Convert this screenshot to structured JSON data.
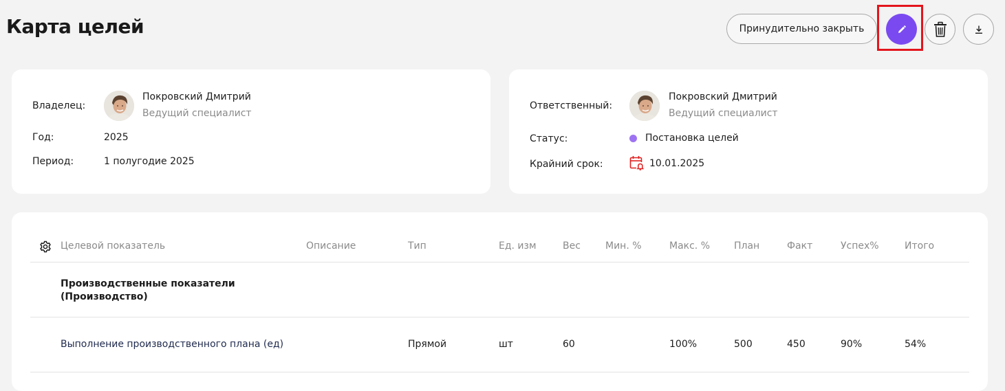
{
  "header": {
    "title": "Карта целей",
    "force_close_label": "Принудительно закрыть",
    "edit_icon": "pencil-icon",
    "delete_icon": "trash-icon",
    "download_icon": "download-icon"
  },
  "info_left": {
    "owner_label": "Владелец:",
    "owner_name": "Покровский Дмитрий",
    "owner_position": "Ведущий специалист",
    "year_label": "Год:",
    "year_value": "2025",
    "period_label": "Период:",
    "period_value": "1 полугодие 2025"
  },
  "info_right": {
    "responsible_label": "Ответственный:",
    "responsible_name": "Покровский Дмитрий",
    "responsible_position": "Ведущий специалист",
    "status_label": "Статус:",
    "status_value": "Постановка целей",
    "status_color": "#9e73f2",
    "deadline_label": "Крайний срок:",
    "deadline_value": "10.01.2025",
    "deadline_icon": "calendar-alarm-icon"
  },
  "table": {
    "settings_icon": "gear-icon",
    "columns": [
      "Целевой показатель",
      "Описание",
      "Тип",
      "Ед. изм",
      "Вес",
      "Мин. %",
      "Макс. %",
      "План",
      "Факт",
      "Успех%",
      "Итого"
    ],
    "group_title": "Производственные показатели (Производство)",
    "rows": [
      {
        "indicator": "Выполнение производственного плана (ед)",
        "description": "",
        "type": "Прямой",
        "unit": "шт",
        "weight": "60",
        "min": "",
        "max": "100%",
        "plan": "500",
        "fact": "450",
        "success": "90%",
        "total": "54%"
      }
    ]
  },
  "colors": {
    "accent": "#7a4af0",
    "highlight": "#e4141c",
    "background": "#f3f3f3"
  }
}
